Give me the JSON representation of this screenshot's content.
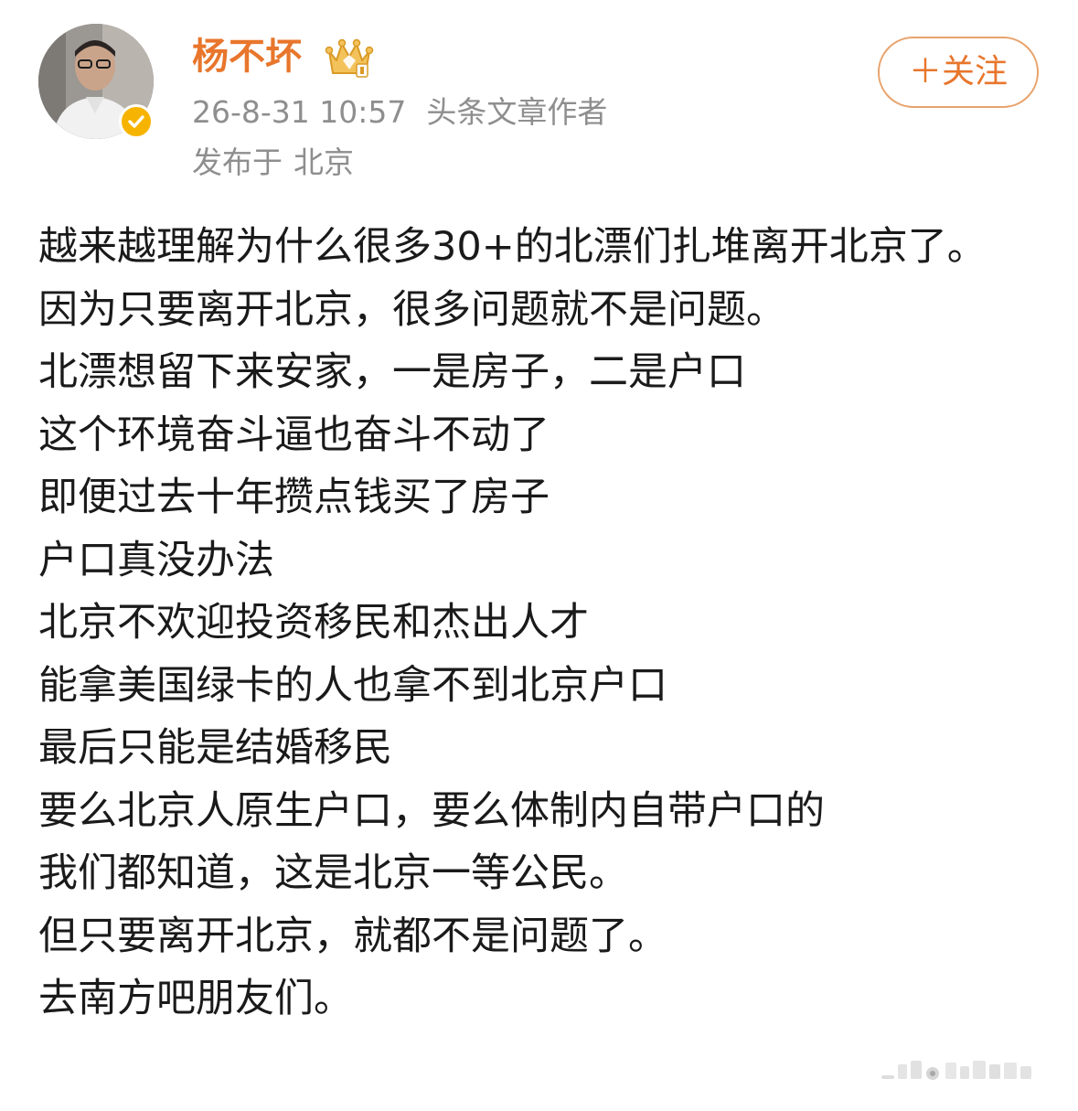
{
  "author": {
    "name": "杨不坏",
    "avatar_icon": "avatar-photo",
    "verified_icon": "verified-check-icon",
    "badge_icon": "crown-badge-icon",
    "verified_color": "#f6b400"
  },
  "meta": {
    "timestamp": "26-8-31 10:57",
    "role": "头条文章作者",
    "location_prefix": "发布于",
    "location": "北京"
  },
  "follow_button": {
    "label": "＋关注"
  },
  "post": {
    "lines": [
      "越来越理解为什么很多30+的北漂们扎堆离开北京了。",
      "因为只要离开北京，很多问题就不是问题。",
      "北漂想留下来安家，一是房子，二是户口",
      "这个环境奋斗逼也奋斗不动了",
      "即便过去十年攒点钱买了房子",
      "户口真没办法",
      "北京不欢迎投资移民和杰出人才",
      "能拿美国绿卡的人也拿不到北京户口",
      "最后只能是结婚移民",
      "要么北京人原生户口，要么体制内自带户口的",
      "我们都知道，这是北京一等公民。",
      "但只要离开北京，就都不是问题了。",
      "去南方吧朋友们。"
    ]
  },
  "colors": {
    "accent": "#e8762c",
    "meta_text": "#8e8e8e",
    "body_text": "#1a1a1a"
  }
}
